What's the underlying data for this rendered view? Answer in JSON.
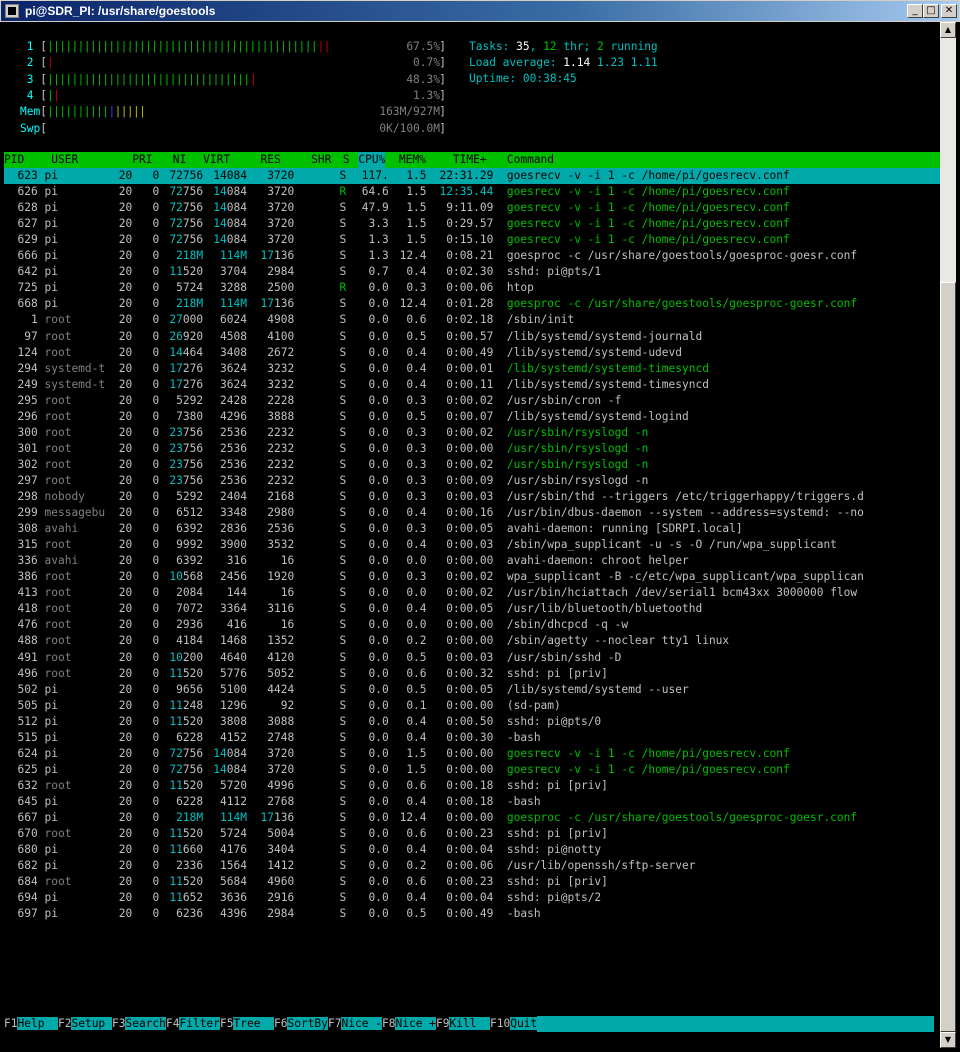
{
  "window": {
    "title": "pi@SDR_PI: /usr/share/goestools",
    "min": "_",
    "max": "□",
    "close": "✕"
  },
  "meters": {
    "cpus": [
      {
        "label": "1",
        "segments": [
          {
            "t": "||||||||||||||||||||||||||||||||||||||||||||",
            "c": "g"
          },
          {
            "t": "||",
            "c": "r"
          }
        ],
        "value": "67.5%"
      },
      {
        "label": "2",
        "segments": [
          {
            "t": "|",
            "c": "r"
          }
        ],
        "value": "0.7%"
      },
      {
        "label": "3",
        "segments": [
          {
            "t": "|||||||||||||||||||||||||||||||||",
            "c": "g"
          },
          {
            "t": "|",
            "c": "r"
          }
        ],
        "value": "48.3%"
      },
      {
        "label": "4",
        "segments": [
          {
            "t": "|",
            "c": "g"
          },
          {
            "t": "|",
            "c": "r"
          }
        ],
        "value": "1.3%"
      }
    ],
    "mem": {
      "label": "Mem",
      "segments": [
        {
          "t": "||||||||||",
          "c": "g"
        },
        {
          "t": "|",
          "c": "b"
        },
        {
          "t": "|||||",
          "c": "y"
        }
      ],
      "value": "163M/927M"
    },
    "swp": {
      "label": "Swp",
      "segments": [],
      "value": "0K/100.0M"
    }
  },
  "stats": {
    "tasks_label": "Tasks: ",
    "tasks": "35",
    "thr_sep": ", ",
    "thr": "12",
    "thr_label": " thr; ",
    "running": "2",
    "running_label": " running",
    "load_label": "Load average: ",
    "load1": "1.14",
    "load5": "1.23",
    "load15": "1.11",
    "uptime_label": "Uptime: ",
    "uptime": "00:38:45"
  },
  "columns": [
    "PID",
    "USER",
    "PRI",
    "NI",
    "VIRT",
    "RES",
    "SHR",
    "S",
    "CPU%",
    "MEM%",
    "TIME+",
    "Command"
  ],
  "processes": [
    {
      "pid": "623",
      "user": "pi",
      "pri": "20",
      "ni": "0",
      "virt": "72756",
      "res": "14084",
      "shr": "3720",
      "s": "S",
      "cpu": "117.",
      "mem": "1.5",
      "time": "22:31.29",
      "cmd": "goesrecv -v -i 1 -c /home/pi/goesrecv.conf",
      "sel": true
    },
    {
      "pid": "626",
      "user": "pi",
      "pri": "20",
      "ni": "0",
      "virt": "72756",
      "res": "14084",
      "shr": "3720",
      "s": "R",
      "cpu": "64.6",
      "mem": "1.5",
      "time": "12:35.44",
      "cmd": "goesrecv -v -i 1 -c /home/pi/goesrecv.conf",
      "thread": true
    },
    {
      "pid": "628",
      "user": "pi",
      "pri": "20",
      "ni": "0",
      "virt": "72756",
      "res": "14084",
      "shr": "3720",
      "s": "S",
      "cpu": "47.9",
      "mem": "1.5",
      "time": "9:11.09",
      "cmd": "goesrecv -v -i 1 -c /home/pi/goesrecv.conf",
      "thread": true
    },
    {
      "pid": "627",
      "user": "pi",
      "pri": "20",
      "ni": "0",
      "virt": "72756",
      "res": "14084",
      "shr": "3720",
      "s": "S",
      "cpu": "3.3",
      "mem": "1.5",
      "time": "0:29.57",
      "cmd": "goesrecv -v -i 1 -c /home/pi/goesrecv.conf",
      "thread": true
    },
    {
      "pid": "629",
      "user": "pi",
      "pri": "20",
      "ni": "0",
      "virt": "72756",
      "res": "14084",
      "shr": "3720",
      "s": "S",
      "cpu": "1.3",
      "mem": "1.5",
      "time": "0:15.10",
      "cmd": "goesrecv -v -i 1 -c /home/pi/goesrecv.conf",
      "thread": true
    },
    {
      "pid": "666",
      "user": "pi",
      "pri": "20",
      "ni": "0",
      "virt": "218M",
      "res": "114M",
      "shr": "17136",
      "s": "S",
      "cpu": "1.3",
      "mem": "12.4",
      "time": "0:08.21",
      "cmd": "goesproc -c /usr/share/goestools/goesproc-goesr.conf"
    },
    {
      "pid": "642",
      "user": "pi",
      "pri": "20",
      "ni": "0",
      "virt": "11520",
      "res": "3704",
      "shr": "2984",
      "s": "S",
      "cpu": "0.7",
      "mem": "0.4",
      "time": "0:02.30",
      "cmd": "sshd: pi@pts/1"
    },
    {
      "pid": "725",
      "user": "pi",
      "pri": "20",
      "ni": "0",
      "virt": "5724",
      "res": "3288",
      "shr": "2500",
      "s": "R",
      "cpu": "0.0",
      "mem": "0.3",
      "time": "0:00.06",
      "cmd": "htop"
    },
    {
      "pid": "668",
      "user": "pi",
      "pri": "20",
      "ni": "0",
      "virt": "218M",
      "res": "114M",
      "shr": "17136",
      "s": "S",
      "cpu": "0.0",
      "mem": "12.4",
      "time": "0:01.28",
      "cmd": "goesproc -c /usr/share/goestools/goesproc-goesr.conf",
      "thread": true
    },
    {
      "pid": "1",
      "user": "root",
      "pri": "20",
      "ni": "0",
      "virt": "27000",
      "res": "6024",
      "shr": "4908",
      "s": "S",
      "cpu": "0.0",
      "mem": "0.6",
      "time": "0:02.18",
      "cmd": "/sbin/init"
    },
    {
      "pid": "97",
      "user": "root",
      "pri": "20",
      "ni": "0",
      "virt": "26920",
      "res": "4508",
      "shr": "4100",
      "s": "S",
      "cpu": "0.0",
      "mem": "0.5",
      "time": "0:00.57",
      "cmd": "/lib/systemd/systemd-journald"
    },
    {
      "pid": "124",
      "user": "root",
      "pri": "20",
      "ni": "0",
      "virt": "14464",
      "res": "3408",
      "shr": "2672",
      "s": "S",
      "cpu": "0.0",
      "mem": "0.4",
      "time": "0:00.49",
      "cmd": "/lib/systemd/systemd-udevd"
    },
    {
      "pid": "294",
      "user": "systemd-t",
      "pri": "20",
      "ni": "0",
      "virt": "17276",
      "res": "3624",
      "shr": "3232",
      "s": "S",
      "cpu": "0.0",
      "mem": "0.4",
      "time": "0:00.01",
      "cmd": "/lib/systemd/systemd-timesyncd",
      "thread": true
    },
    {
      "pid": "249",
      "user": "systemd-t",
      "pri": "20",
      "ni": "0",
      "virt": "17276",
      "res": "3624",
      "shr": "3232",
      "s": "S",
      "cpu": "0.0",
      "mem": "0.4",
      "time": "0:00.11",
      "cmd": "/lib/systemd/systemd-timesyncd"
    },
    {
      "pid": "295",
      "user": "root",
      "pri": "20",
      "ni": "0",
      "virt": "5292",
      "res": "2428",
      "shr": "2228",
      "s": "S",
      "cpu": "0.0",
      "mem": "0.3",
      "time": "0:00.02",
      "cmd": "/usr/sbin/cron -f"
    },
    {
      "pid": "296",
      "user": "root",
      "pri": "20",
      "ni": "0",
      "virt": "7380",
      "res": "4296",
      "shr": "3888",
      "s": "S",
      "cpu": "0.0",
      "mem": "0.5",
      "time": "0:00.07",
      "cmd": "/lib/systemd/systemd-logind"
    },
    {
      "pid": "300",
      "user": "root",
      "pri": "20",
      "ni": "0",
      "virt": "23756",
      "res": "2536",
      "shr": "2232",
      "s": "S",
      "cpu": "0.0",
      "mem": "0.3",
      "time": "0:00.02",
      "cmd": "/usr/sbin/rsyslogd -n",
      "thread": true
    },
    {
      "pid": "301",
      "user": "root",
      "pri": "20",
      "ni": "0",
      "virt": "23756",
      "res": "2536",
      "shr": "2232",
      "s": "S",
      "cpu": "0.0",
      "mem": "0.3",
      "time": "0:00.00",
      "cmd": "/usr/sbin/rsyslogd -n",
      "thread": true
    },
    {
      "pid": "302",
      "user": "root",
      "pri": "20",
      "ni": "0",
      "virt": "23756",
      "res": "2536",
      "shr": "2232",
      "s": "S",
      "cpu": "0.0",
      "mem": "0.3",
      "time": "0:00.02",
      "cmd": "/usr/sbin/rsyslogd -n",
      "thread": true
    },
    {
      "pid": "297",
      "user": "root",
      "pri": "20",
      "ni": "0",
      "virt": "23756",
      "res": "2536",
      "shr": "2232",
      "s": "S",
      "cpu": "0.0",
      "mem": "0.3",
      "time": "0:00.09",
      "cmd": "/usr/sbin/rsyslogd -n"
    },
    {
      "pid": "298",
      "user": "nobody",
      "pri": "20",
      "ni": "0",
      "virt": "5292",
      "res": "2404",
      "shr": "2168",
      "s": "S",
      "cpu": "0.0",
      "mem": "0.3",
      "time": "0:00.03",
      "cmd": "/usr/sbin/thd --triggers /etc/triggerhappy/triggers.d"
    },
    {
      "pid": "299",
      "user": "messagebu",
      "pri": "20",
      "ni": "0",
      "virt": "6512",
      "res": "3348",
      "shr": "2980",
      "s": "S",
      "cpu": "0.0",
      "mem": "0.4",
      "time": "0:00.16",
      "cmd": "/usr/bin/dbus-daemon --system --address=systemd: --no"
    },
    {
      "pid": "308",
      "user": "avahi",
      "pri": "20",
      "ni": "0",
      "virt": "6392",
      "res": "2836",
      "shr": "2536",
      "s": "S",
      "cpu": "0.0",
      "mem": "0.3",
      "time": "0:00.05",
      "cmd": "avahi-daemon: running [SDRPI.local]"
    },
    {
      "pid": "315",
      "user": "root",
      "pri": "20",
      "ni": "0",
      "virt": "9992",
      "res": "3900",
      "shr": "3532",
      "s": "S",
      "cpu": "0.0",
      "mem": "0.4",
      "time": "0:00.03",
      "cmd": "/sbin/wpa_supplicant -u -s -O /run/wpa_supplicant"
    },
    {
      "pid": "336",
      "user": "avahi",
      "pri": "20",
      "ni": "0",
      "virt": "6392",
      "res": "316",
      "shr": "16",
      "s": "S",
      "cpu": "0.0",
      "mem": "0.0",
      "time": "0:00.00",
      "cmd": "avahi-daemon: chroot helper"
    },
    {
      "pid": "386",
      "user": "root",
      "pri": "20",
      "ni": "0",
      "virt": "10568",
      "res": "2456",
      "shr": "1920",
      "s": "S",
      "cpu": "0.0",
      "mem": "0.3",
      "time": "0:00.02",
      "cmd": "wpa_supplicant -B -c/etc/wpa_supplicant/wpa_supplican"
    },
    {
      "pid": "413",
      "user": "root",
      "pri": "20",
      "ni": "0",
      "virt": "2084",
      "res": "144",
      "shr": "16",
      "s": "S",
      "cpu": "0.0",
      "mem": "0.0",
      "time": "0:00.02",
      "cmd": "/usr/bin/hciattach /dev/serial1 bcm43xx 3000000 flow"
    },
    {
      "pid": "418",
      "user": "root",
      "pri": "20",
      "ni": "0",
      "virt": "7072",
      "res": "3364",
      "shr": "3116",
      "s": "S",
      "cpu": "0.0",
      "mem": "0.4",
      "time": "0:00.05",
      "cmd": "/usr/lib/bluetooth/bluetoothd"
    },
    {
      "pid": "476",
      "user": "root",
      "pri": "20",
      "ni": "0",
      "virt": "2936",
      "res": "416",
      "shr": "16",
      "s": "S",
      "cpu": "0.0",
      "mem": "0.0",
      "time": "0:00.00",
      "cmd": "/sbin/dhcpcd -q -w"
    },
    {
      "pid": "488",
      "user": "root",
      "pri": "20",
      "ni": "0",
      "virt": "4184",
      "res": "1468",
      "shr": "1352",
      "s": "S",
      "cpu": "0.0",
      "mem": "0.2",
      "time": "0:00.00",
      "cmd": "/sbin/agetty --noclear tty1 linux"
    },
    {
      "pid": "491",
      "user": "root",
      "pri": "20",
      "ni": "0",
      "virt": "10200",
      "res": "4640",
      "shr": "4120",
      "s": "S",
      "cpu": "0.0",
      "mem": "0.5",
      "time": "0:00.03",
      "cmd": "/usr/sbin/sshd -D"
    },
    {
      "pid": "496",
      "user": "root",
      "pri": "20",
      "ni": "0",
      "virt": "11520",
      "res": "5776",
      "shr": "5052",
      "s": "S",
      "cpu": "0.0",
      "mem": "0.6",
      "time": "0:00.32",
      "cmd": "sshd: pi [priv]"
    },
    {
      "pid": "502",
      "user": "pi",
      "pri": "20",
      "ni": "0",
      "virt": "9656",
      "res": "5100",
      "shr": "4424",
      "s": "S",
      "cpu": "0.0",
      "mem": "0.5",
      "time": "0:00.05",
      "cmd": "/lib/systemd/systemd --user"
    },
    {
      "pid": "505",
      "user": "pi",
      "pri": "20",
      "ni": "0",
      "virt": "11248",
      "res": "1296",
      "shr": "92",
      "s": "S",
      "cpu": "0.0",
      "mem": "0.1",
      "time": "0:00.00",
      "cmd": "(sd-pam)"
    },
    {
      "pid": "512",
      "user": "pi",
      "pri": "20",
      "ni": "0",
      "virt": "11520",
      "res": "3808",
      "shr": "3088",
      "s": "S",
      "cpu": "0.0",
      "mem": "0.4",
      "time": "0:00.50",
      "cmd": "sshd: pi@pts/0"
    },
    {
      "pid": "515",
      "user": "pi",
      "pri": "20",
      "ni": "0",
      "virt": "6228",
      "res": "4152",
      "shr": "2748",
      "s": "S",
      "cpu": "0.0",
      "mem": "0.4",
      "time": "0:00.30",
      "cmd": "-bash"
    },
    {
      "pid": "624",
      "user": "pi",
      "pri": "20",
      "ni": "0",
      "virt": "72756",
      "res": "14084",
      "shr": "3720",
      "s": "S",
      "cpu": "0.0",
      "mem": "1.5",
      "time": "0:00.00",
      "cmd": "goesrecv -v -i 1 -c /home/pi/goesrecv.conf",
      "thread": true
    },
    {
      "pid": "625",
      "user": "pi",
      "pri": "20",
      "ni": "0",
      "virt": "72756",
      "res": "14084",
      "shr": "3720",
      "s": "S",
      "cpu": "0.0",
      "mem": "1.5",
      "time": "0:00.00",
      "cmd": "goesrecv -v -i 1 -c /home/pi/goesrecv.conf",
      "thread": true
    },
    {
      "pid": "632",
      "user": "root",
      "pri": "20",
      "ni": "0",
      "virt": "11520",
      "res": "5720",
      "shr": "4996",
      "s": "S",
      "cpu": "0.0",
      "mem": "0.6",
      "time": "0:00.18",
      "cmd": "sshd: pi [priv]"
    },
    {
      "pid": "645",
      "user": "pi",
      "pri": "20",
      "ni": "0",
      "virt": "6228",
      "res": "4112",
      "shr": "2768",
      "s": "S",
      "cpu": "0.0",
      "mem": "0.4",
      "time": "0:00.18",
      "cmd": "-bash"
    },
    {
      "pid": "667",
      "user": "pi",
      "pri": "20",
      "ni": "0",
      "virt": "218M",
      "res": "114M",
      "shr": "17136",
      "s": "S",
      "cpu": "0.0",
      "mem": "12.4",
      "time": "0:00.00",
      "cmd": "goesproc -c /usr/share/goestools/goesproc-goesr.conf",
      "thread": true
    },
    {
      "pid": "670",
      "user": "root",
      "pri": "20",
      "ni": "0",
      "virt": "11520",
      "res": "5724",
      "shr": "5004",
      "s": "S",
      "cpu": "0.0",
      "mem": "0.6",
      "time": "0:00.23",
      "cmd": "sshd: pi [priv]"
    },
    {
      "pid": "680",
      "user": "pi",
      "pri": "20",
      "ni": "0",
      "virt": "11660",
      "res": "4176",
      "shr": "3404",
      "s": "S",
      "cpu": "0.0",
      "mem": "0.4",
      "time": "0:00.04",
      "cmd": "sshd: pi@notty"
    },
    {
      "pid": "682",
      "user": "pi",
      "pri": "20",
      "ni": "0",
      "virt": "2336",
      "res": "1564",
      "shr": "1412",
      "s": "S",
      "cpu": "0.0",
      "mem": "0.2",
      "time": "0:00.06",
      "cmd": "/usr/lib/openssh/sftp-server"
    },
    {
      "pid": "684",
      "user": "root",
      "pri": "20",
      "ni": "0",
      "virt": "11520",
      "res": "5684",
      "shr": "4960",
      "s": "S",
      "cpu": "0.0",
      "mem": "0.6",
      "time": "0:00.23",
      "cmd": "sshd: pi [priv]"
    },
    {
      "pid": "694",
      "user": "pi",
      "pri": "20",
      "ni": "0",
      "virt": "11652",
      "res": "3636",
      "shr": "2916",
      "s": "S",
      "cpu": "0.0",
      "mem": "0.4",
      "time": "0:00.04",
      "cmd": "sshd: pi@pts/2"
    },
    {
      "pid": "697",
      "user": "pi",
      "pri": "20",
      "ni": "0",
      "virt": "6236",
      "res": "4396",
      "shr": "2984",
      "s": "S",
      "cpu": "0.0",
      "mem": "0.5",
      "time": "0:00.49",
      "cmd": "-bash"
    }
  ],
  "fkeys": [
    {
      "key": "F1",
      "label": "Help  "
    },
    {
      "key": "F2",
      "label": "Setup "
    },
    {
      "key": "F3",
      "label": "Search"
    },
    {
      "key": "F4",
      "label": "Filter"
    },
    {
      "key": "F5",
      "label": "Tree  "
    },
    {
      "key": "F6",
      "label": "SortBy"
    },
    {
      "key": "F7",
      "label": "Nice -"
    },
    {
      "key": "F8",
      "label": "Nice +"
    },
    {
      "key": "F9",
      "label": "Kill  "
    },
    {
      "key": "F10",
      "label": "Quit"
    }
  ],
  "colors": {
    "header_bg": "#00c000",
    "selected_bg": "#00aaaa",
    "fkey_bg": "#00aaaa",
    "thread_cmd": "#00c000",
    "root_user": "#808080"
  }
}
